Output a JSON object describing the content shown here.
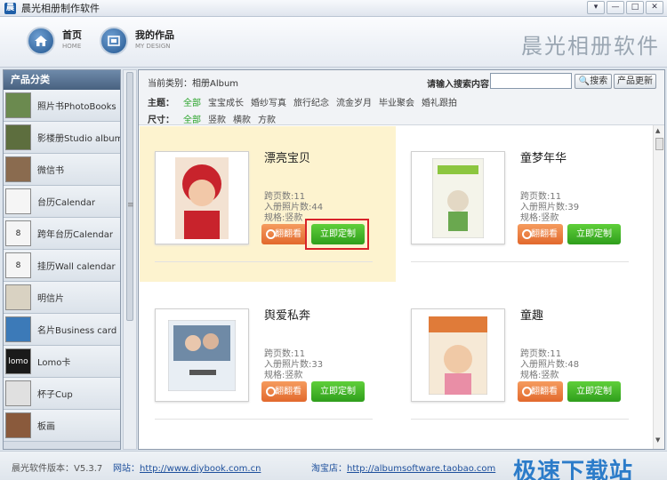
{
  "window": {
    "title": "晨光相册制作软件",
    "controls": [
      "▾",
      "—",
      "□",
      "✕"
    ]
  },
  "header": {
    "nav": [
      {
        "label": "首页",
        "sub": "HOME"
      },
      {
        "label": "我的作品",
        "sub": "MY DESIGN"
      }
    ],
    "brand": "晨光相册软件"
  },
  "sidebar": {
    "title": "产品分类",
    "items": [
      {
        "label": "照片书PhotoBooks"
      },
      {
        "label": "影楼册Studio album"
      },
      {
        "label": "微信书"
      },
      {
        "label": "台历Calendar"
      },
      {
        "label": "跨年台历Calendar"
      },
      {
        "label": "挂历Wall calendar"
      },
      {
        "label": "明信片"
      },
      {
        "label": "名片Business card"
      },
      {
        "label": "Lomo卡"
      },
      {
        "label": "杯子Cup"
      },
      {
        "label": "板画"
      }
    ],
    "thumb_texts": [
      "",
      "",
      "",
      "",
      "8",
      "8",
      "",
      "",
      "lomo",
      "",
      ""
    ],
    "thumb_colors": [
      "#6b8a4f",
      "#5d6e3e",
      "#8a6b4f",
      "#f5f5f5",
      "#f5f5f5",
      "#f5f5f5",
      "#d9d2c2",
      "#3c7ab8",
      "#1a1a1a",
      "#e0e0e0",
      "#8a5a3c"
    ]
  },
  "filters": {
    "crumb": "当前类别：相册Album",
    "search_label": "请输入搜索内容：",
    "search_value": "",
    "search_button": "搜索",
    "update_button": "产品更新",
    "theme_label": "主题：",
    "themes": [
      "全部",
      "宝宝成长",
      "婚纱写真",
      "旅行纪念",
      "流金岁月",
      "毕业聚会",
      "婚礼跟拍"
    ],
    "size_label": "尺寸：",
    "sizes": [
      "全部",
      "竖款",
      "横款",
      "方款"
    ]
  },
  "cards": [
    {
      "title": "漂亮宝贝",
      "pages": "跨页数:11",
      "photos": "入册照片数:44",
      "spec": "规格:竖款",
      "preview": "翻翻看",
      "custom": "立即定制"
    },
    {
      "title": "童梦年华",
      "pages": "跨页数:11",
      "photos": "入册照片数:39",
      "spec": "规格:竖款",
      "preview": "翻翻看",
      "custom": "立即定制"
    },
    {
      "title": "舆爱私奔",
      "pages": "跨页数:11",
      "photos": "入册照片数:33",
      "spec": "规格:竖款",
      "preview": "翻翻看",
      "custom": "立即定制"
    },
    {
      "title": "童趣",
      "pages": "跨页数:11",
      "photos": "入册照片数:48",
      "spec": "规格:竖款",
      "preview": "翻翻看",
      "custom": "立即定制"
    }
  ],
  "footer": {
    "version": "晨光软件版本：V5.3.7",
    "site_label": "网站：",
    "site_url": "http://www.diybook.com.cn",
    "shop_label": "淘宝店：",
    "shop_url": "http://albumsoftware.taobao.com",
    "watermark": "极速下载站"
  },
  "colors": {
    "accent_green": "#29a329",
    "preview_orange": "#e2692d",
    "custom_green": "#2f9e1c",
    "highlight_box": "#d8232a",
    "selected_card_bg": "#fdf3cf"
  }
}
